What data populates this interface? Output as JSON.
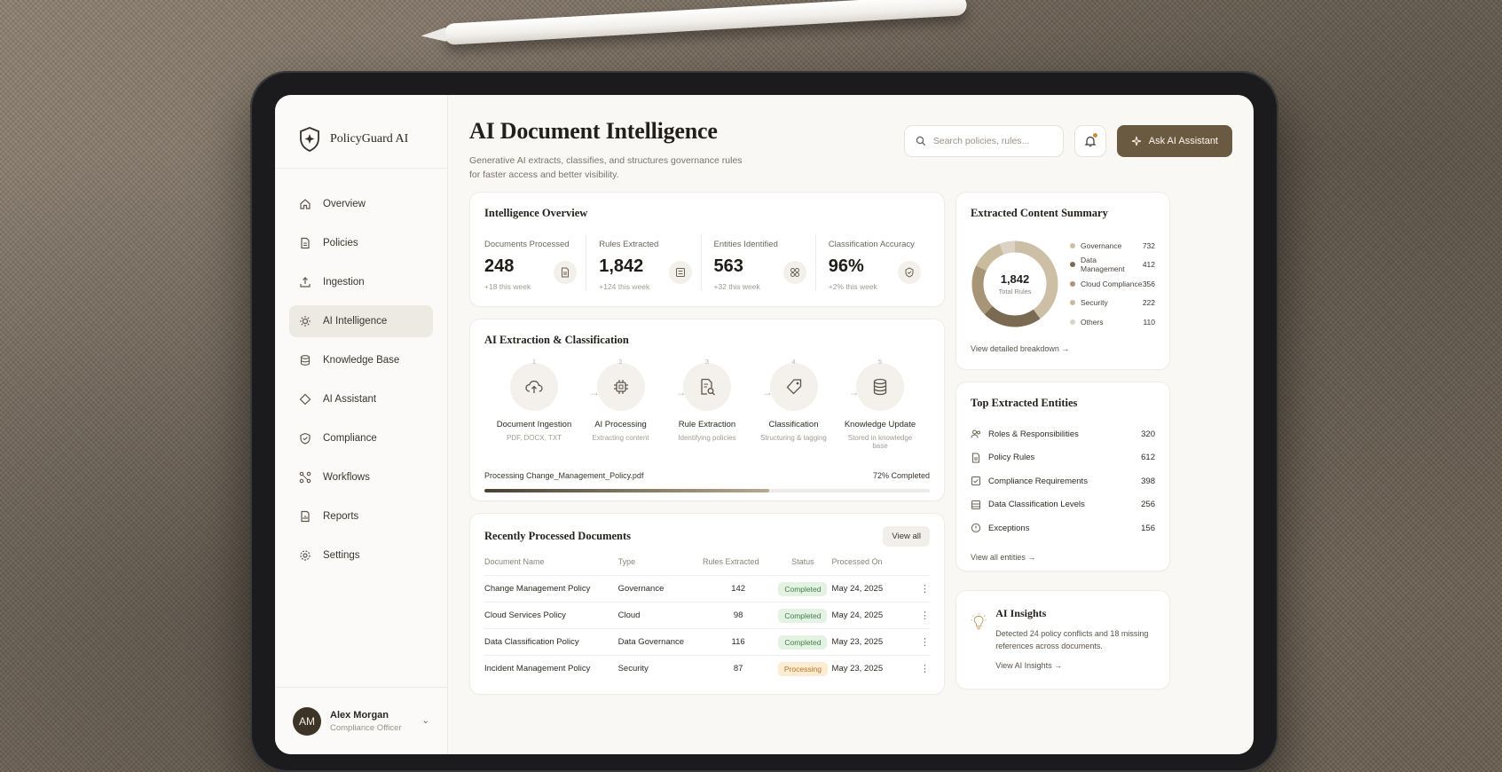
{
  "brand": {
    "name": "PolicyGuard AI"
  },
  "sidebar": {
    "items": [
      {
        "label": "Overview",
        "icon": "home-icon"
      },
      {
        "label": "Policies",
        "icon": "document-icon"
      },
      {
        "label": "Ingestion",
        "icon": "upload-icon"
      },
      {
        "label": "AI Intelligence",
        "icon": "sparkle-chip-icon"
      },
      {
        "label": "Knowledge Base",
        "icon": "database-icon"
      },
      {
        "label": "AI Assistant",
        "icon": "chat-icon"
      },
      {
        "label": "Compliance",
        "icon": "shield-check-icon"
      },
      {
        "label": "Workflows",
        "icon": "workflow-icon"
      },
      {
        "label": "Reports",
        "icon": "report-icon"
      },
      {
        "label": "Settings",
        "icon": "gear-icon"
      }
    ],
    "active": "AI Intelligence"
  },
  "user": {
    "initials": "AM",
    "name": "Alex Morgan",
    "role": "Compliance Officer"
  },
  "header": {
    "title": "AI Document Intelligence",
    "subtitle": "Generative AI extracts, classifies, and structures governance rules for faster access and better visibility.",
    "search_placeholder": "Search policies, rules...",
    "ask_label": "Ask AI Assistant"
  },
  "overview": {
    "title": "Intelligence Overview",
    "stats": [
      {
        "label": "Documents Processed",
        "value": "248",
        "delta": "+18 this week"
      },
      {
        "label": "Rules Extracted",
        "value": "1,842",
        "delta": "+124 this week"
      },
      {
        "label": "Entities Identified",
        "value": "563",
        "delta": "+32 this week"
      },
      {
        "label": "Classification Accuracy",
        "value": "96%",
        "delta": "+2% this week"
      }
    ]
  },
  "pipeline": {
    "title": "AI Extraction & Classification",
    "steps": [
      {
        "num": "1",
        "label": "Document Ingestion",
        "sub": "PDF, DOCX, TXT"
      },
      {
        "num": "2",
        "label": "AI Processing",
        "sub": "Extracting content"
      },
      {
        "num": "3",
        "label": "Rule Extraction",
        "sub": "Identifying policies"
      },
      {
        "num": "4",
        "label": "Classification",
        "sub": "Structuring & tagging"
      },
      {
        "num": "5",
        "label": "Knowledge Update",
        "sub": "Stored in knowledge base"
      }
    ],
    "processing_label": "Processing Change_Management_Policy.pdf",
    "progress_label": "72% Completed",
    "progress": 0.64
  },
  "documents": {
    "title": "Recently Processed Documents",
    "view_all": "View all",
    "columns": [
      "Document Name",
      "Type",
      "Rules Extracted",
      "Status",
      "Processed On"
    ],
    "rows": [
      {
        "name": "Change Management Policy",
        "type": "Governance",
        "rules": "142",
        "status": "Completed",
        "date": "May 24, 2025"
      },
      {
        "name": "Cloud Services Policy",
        "type": "Cloud",
        "rules": "98",
        "status": "Completed",
        "date": "May 24, 2025"
      },
      {
        "name": "Data Classification Policy",
        "type": "Data Governance",
        "rules": "116",
        "status": "Completed",
        "date": "May 23, 2025"
      },
      {
        "name": "Incident Management Policy",
        "type": "Security",
        "rules": "87",
        "status": "Processing",
        "date": "May 23, 2025"
      }
    ]
  },
  "summary": {
    "title": "Extracted Content Summary",
    "total": "1,842",
    "total_label": "Total Rules",
    "link": "View detailed breakdown →",
    "segments": [
      {
        "label": "Governance",
        "value": 732,
        "color": "#cdbfa6"
      },
      {
        "label": "Data Management",
        "value": 412,
        "color": "#7a6a52"
      },
      {
        "label": "Cloud Compliance",
        "value": 356,
        "color": "#a89578"
      },
      {
        "label": "Security",
        "value": 222,
        "color": "#c9bb9d"
      },
      {
        "label": "Others",
        "value": 110,
        "color": "#dad3c6"
      }
    ]
  },
  "entities": {
    "title": "Top Extracted Entities",
    "link": "View all entities →",
    "items": [
      {
        "label": "Roles & Responsibilities",
        "count": "320"
      },
      {
        "label": "Policy Rules",
        "count": "612"
      },
      {
        "label": "Compliance Requirements",
        "count": "398"
      },
      {
        "label": "Data Classification Levels",
        "count": "256"
      },
      {
        "label": "Exceptions",
        "count": "156"
      }
    ]
  },
  "insights": {
    "title": "AI Insights",
    "text": "Detected 24 policy conflicts and 18 missing references across documents.",
    "link": "View AI Insights →"
  }
}
